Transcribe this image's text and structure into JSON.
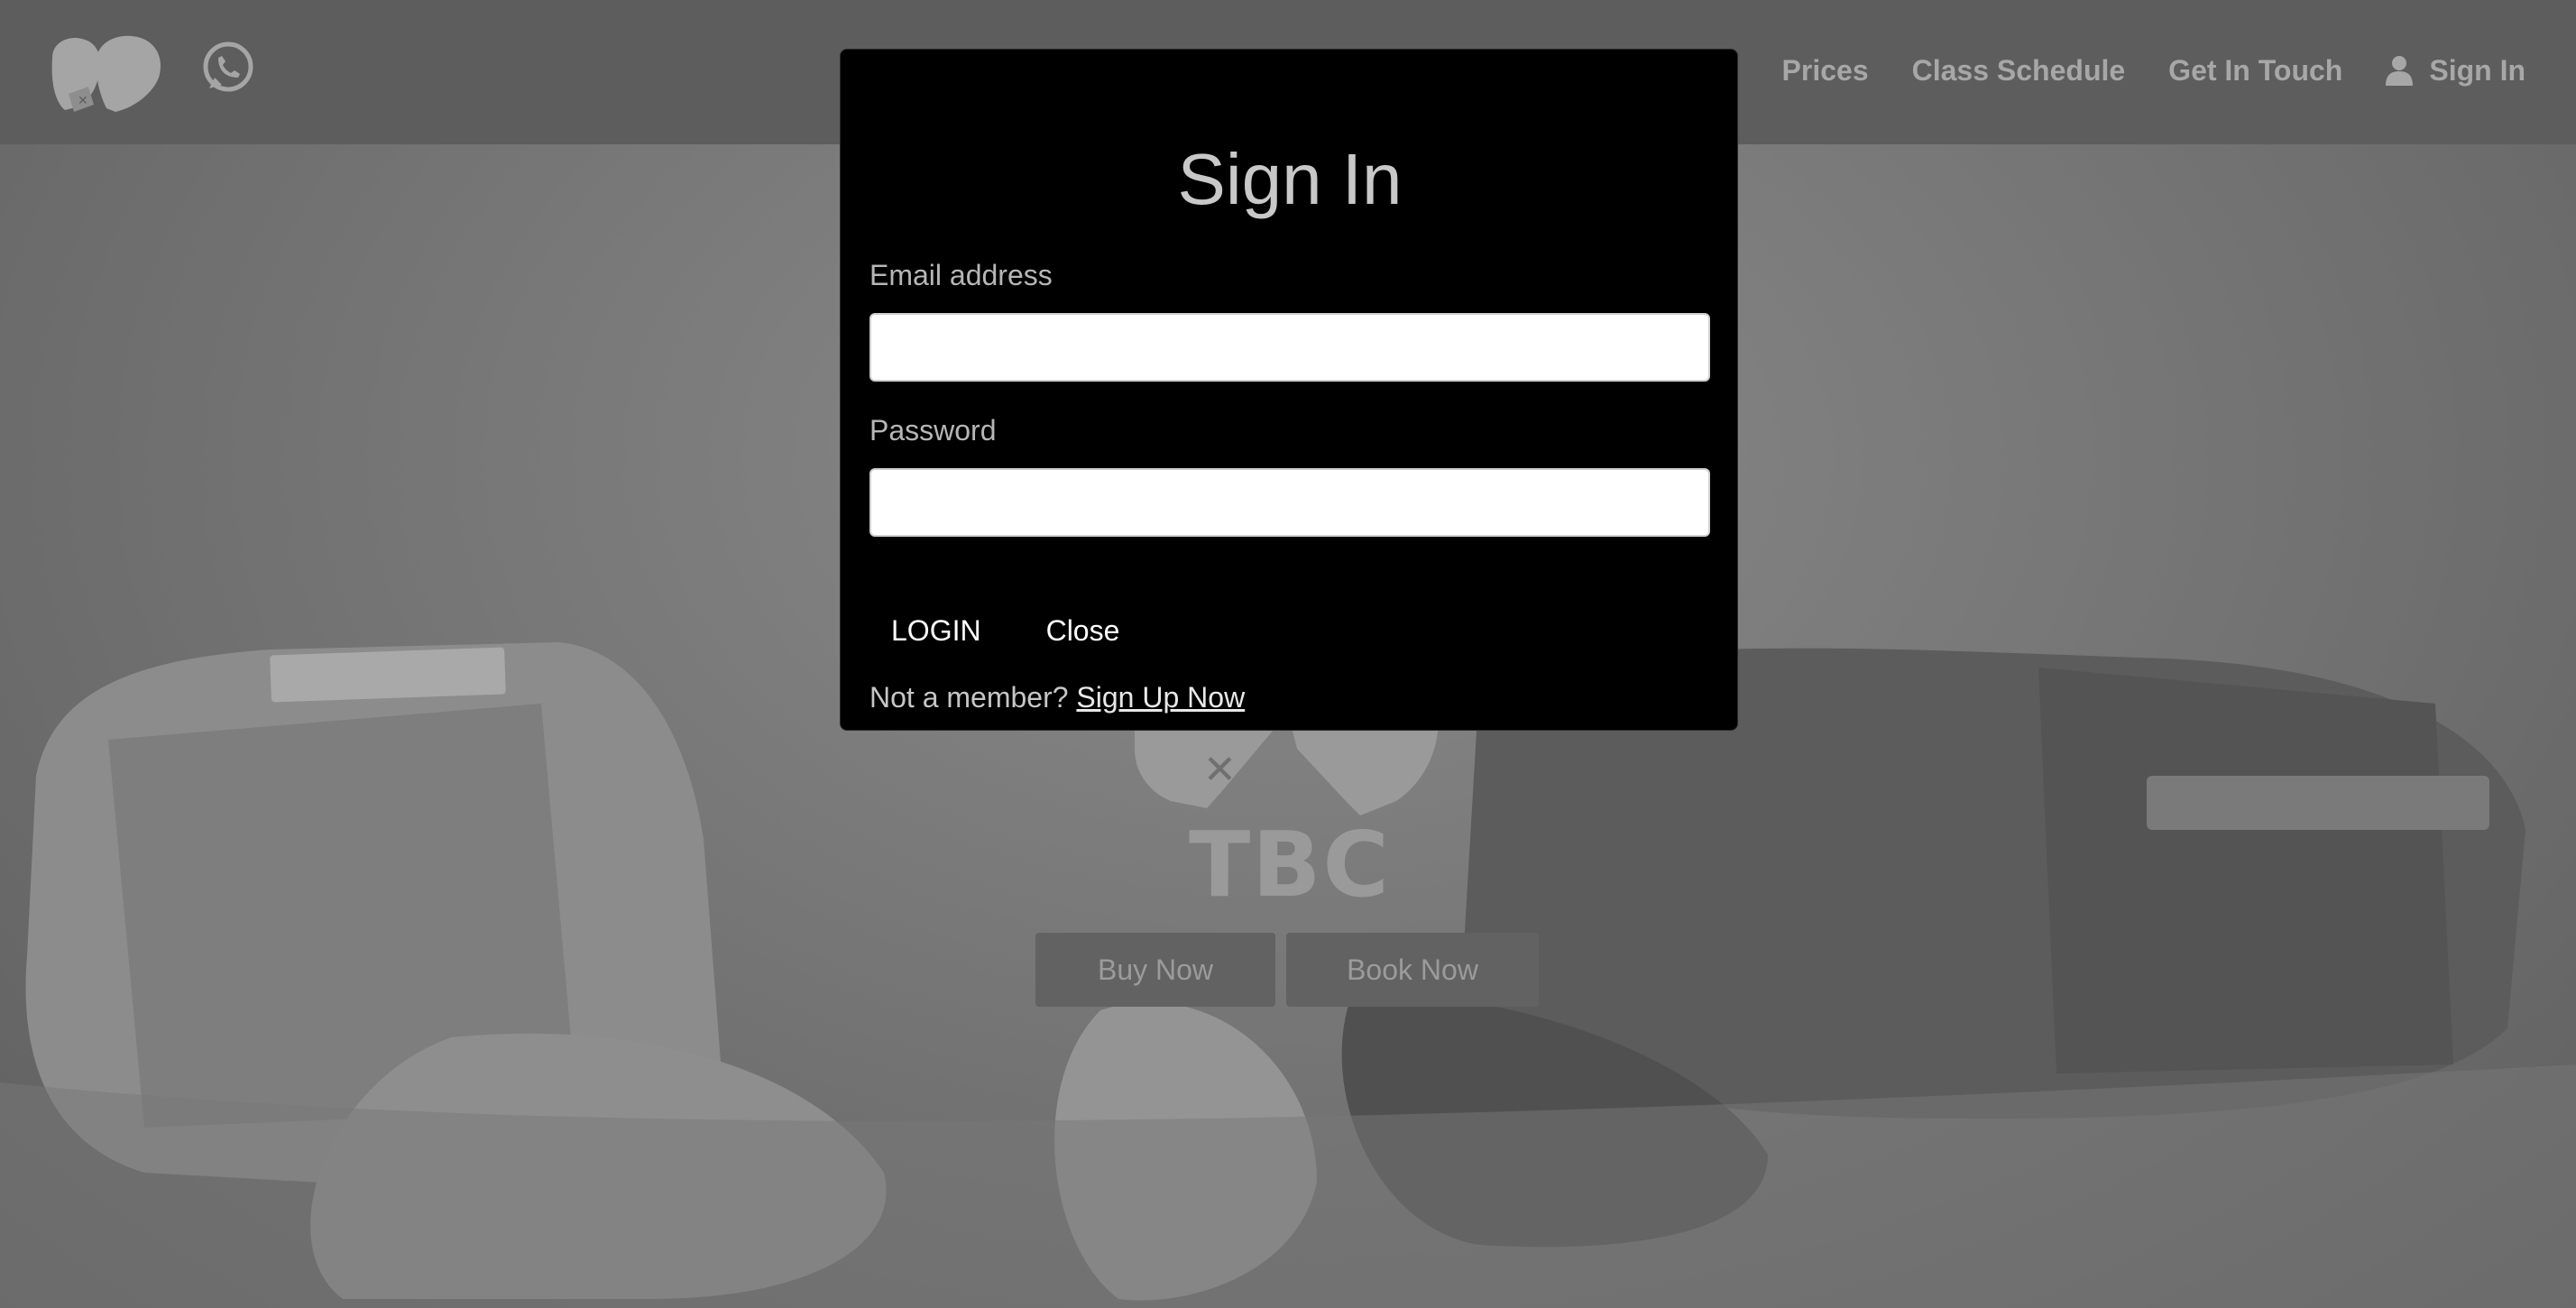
{
  "colors": {
    "overlay": "#6a6a6a",
    "navbar": "#5d5d5d",
    "nav_text": "#a7a7a7",
    "modal_bg": "#000000",
    "modal_title": "#c8c8c8",
    "input_bg": "#ffffff"
  },
  "navbar": {
    "logo_icon": "boxing-gloves-icon",
    "whatsapp_icon": "whatsapp-icon",
    "links": [
      {
        "label": "Prices"
      },
      {
        "label": "Class Schedule"
      },
      {
        "label": "Get In Touch"
      },
      {
        "label": "Sign In",
        "icon": "user-icon"
      }
    ]
  },
  "hero": {
    "brand": "TBC",
    "buttons": {
      "buy": "Buy Now",
      "book": "Book Now"
    }
  },
  "modal": {
    "title": "Sign In",
    "email_label": "Email address",
    "email_value": "",
    "password_label": "Password",
    "password_value": "",
    "login_label": "LOGIN",
    "close_label": "Close",
    "signup_prompt": "Not a member?",
    "signup_link": "Sign Up Now"
  }
}
